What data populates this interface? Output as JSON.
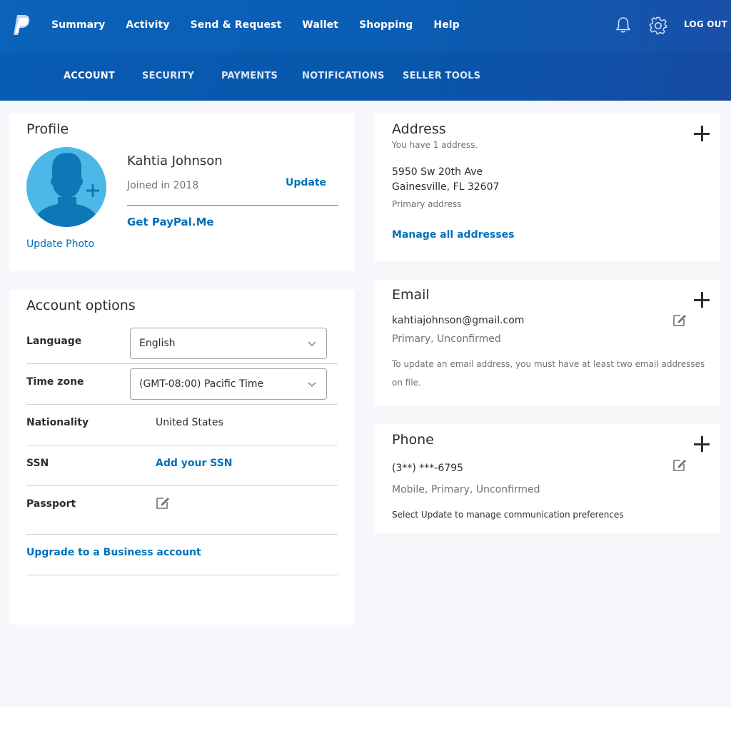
{
  "nav": {
    "brand": "PayPal",
    "items": [
      "Summary",
      "Activity",
      "Send & Request",
      "Wallet",
      "Shopping",
      "Help"
    ],
    "logout": "LOG OUT",
    "notifications_icon": "bell-icon",
    "settings_icon": "gear-icon"
  },
  "subnav": {
    "tabs": [
      "ACCOUNT",
      "SECURITY",
      "PAYMENTS",
      "NOTIFICATIONS",
      "SELLER TOOLS"
    ],
    "active": "ACCOUNT"
  },
  "profile": {
    "title": "Profile",
    "name": "Kahtia Johnson",
    "joined": "Joined in 2018",
    "update": "Update",
    "paypal_me": "Get PayPal.Me",
    "update_photo": "Update Photo"
  },
  "account_options": {
    "title": "Account options",
    "language_label": "Language",
    "language_value": "English",
    "timezone_label": "Time zone",
    "timezone_value": "(GMT-08:00) Pacific Time",
    "nationality_label": "Nationality",
    "nationality_value": "United States",
    "ssn_label": "SSN",
    "ssn_link": "Add your SSN",
    "passport_label": "Passport",
    "upgrade_link": "Upgrade to a Business account"
  },
  "address": {
    "title": "Address",
    "count": "You have 1 address.",
    "line1": "5950 Sw 20th Ave",
    "line2": "Gainesville, FL 32607",
    "type": "Primary address",
    "manage": "Manage all addresses"
  },
  "email": {
    "title": "Email",
    "address": "kahtiajohnson@gmail.com",
    "status": "Primary, Unconfirmed",
    "note_line1": "To update an email address, you must have at least two email addresses",
    "note_line2": "on file."
  },
  "phone": {
    "title": "Phone",
    "number": "(3**) ***-6795",
    "status": "Mobile, Primary, Unconfirmed",
    "note": "Select Update to manage communication preferences"
  },
  "colors": {
    "brand_blue": "#0a62b9",
    "link_blue": "#0070ba",
    "avatar_bg": "#4cb8e8",
    "avatar_fg": "#0e77b6",
    "page_bg": "#f5f7fa"
  }
}
